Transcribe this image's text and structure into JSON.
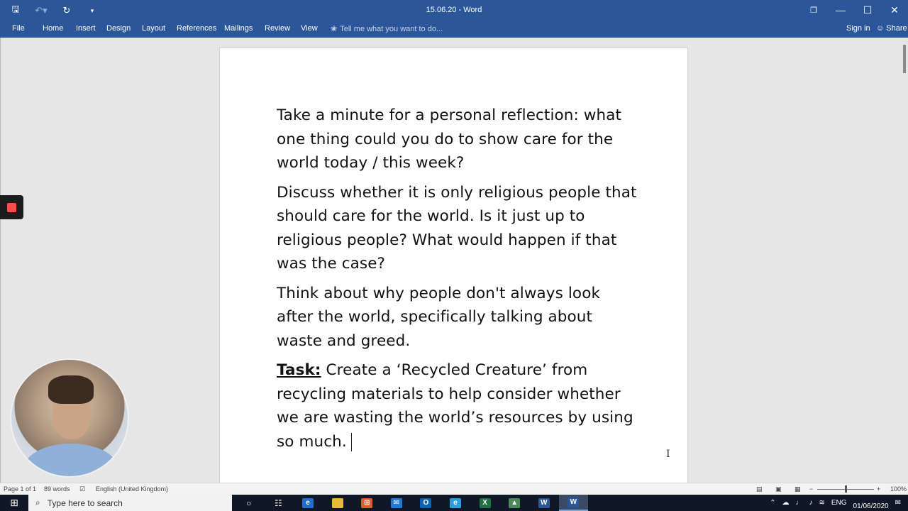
{
  "window": {
    "title": "15.06.20 - Word"
  },
  "qat": {
    "save_icon": "save-icon",
    "undo_icon": "undo-icon",
    "redo_icon": "redo-icon",
    "customize_icon": "customize-qat-icon"
  },
  "ribbon": {
    "tabs": [
      "File",
      "Home",
      "Insert",
      "Design",
      "Layout",
      "References",
      "Mailings",
      "Review",
      "View"
    ],
    "tell_me": "Tell me what you want to do...",
    "sign_in": "Sign in",
    "share": "Share"
  },
  "document": {
    "paragraphs": [
      "Take a minute for a personal reflection: what one thing could you do to show care for the world today / this week?",
      "Discuss whether it is only religious people that should care for the world. Is it just up to religious people? What would happen if that was the case?",
      "Think about why people don't always look after the world, specifically talking about waste and greed."
    ],
    "task_label": "Task:",
    "task_text": "Create a ‘Recycled Creature’ from recycling materials to help consider whether we are wasting the world’s resources by using so much."
  },
  "status": {
    "page": "Page 1 of 1",
    "words": "89 words",
    "language": "English (United Kingdom)",
    "zoom": "100%"
  },
  "taskbar": {
    "search_placeholder": "Type here to search",
    "language": "ENG",
    "date": "01/06/2020"
  }
}
